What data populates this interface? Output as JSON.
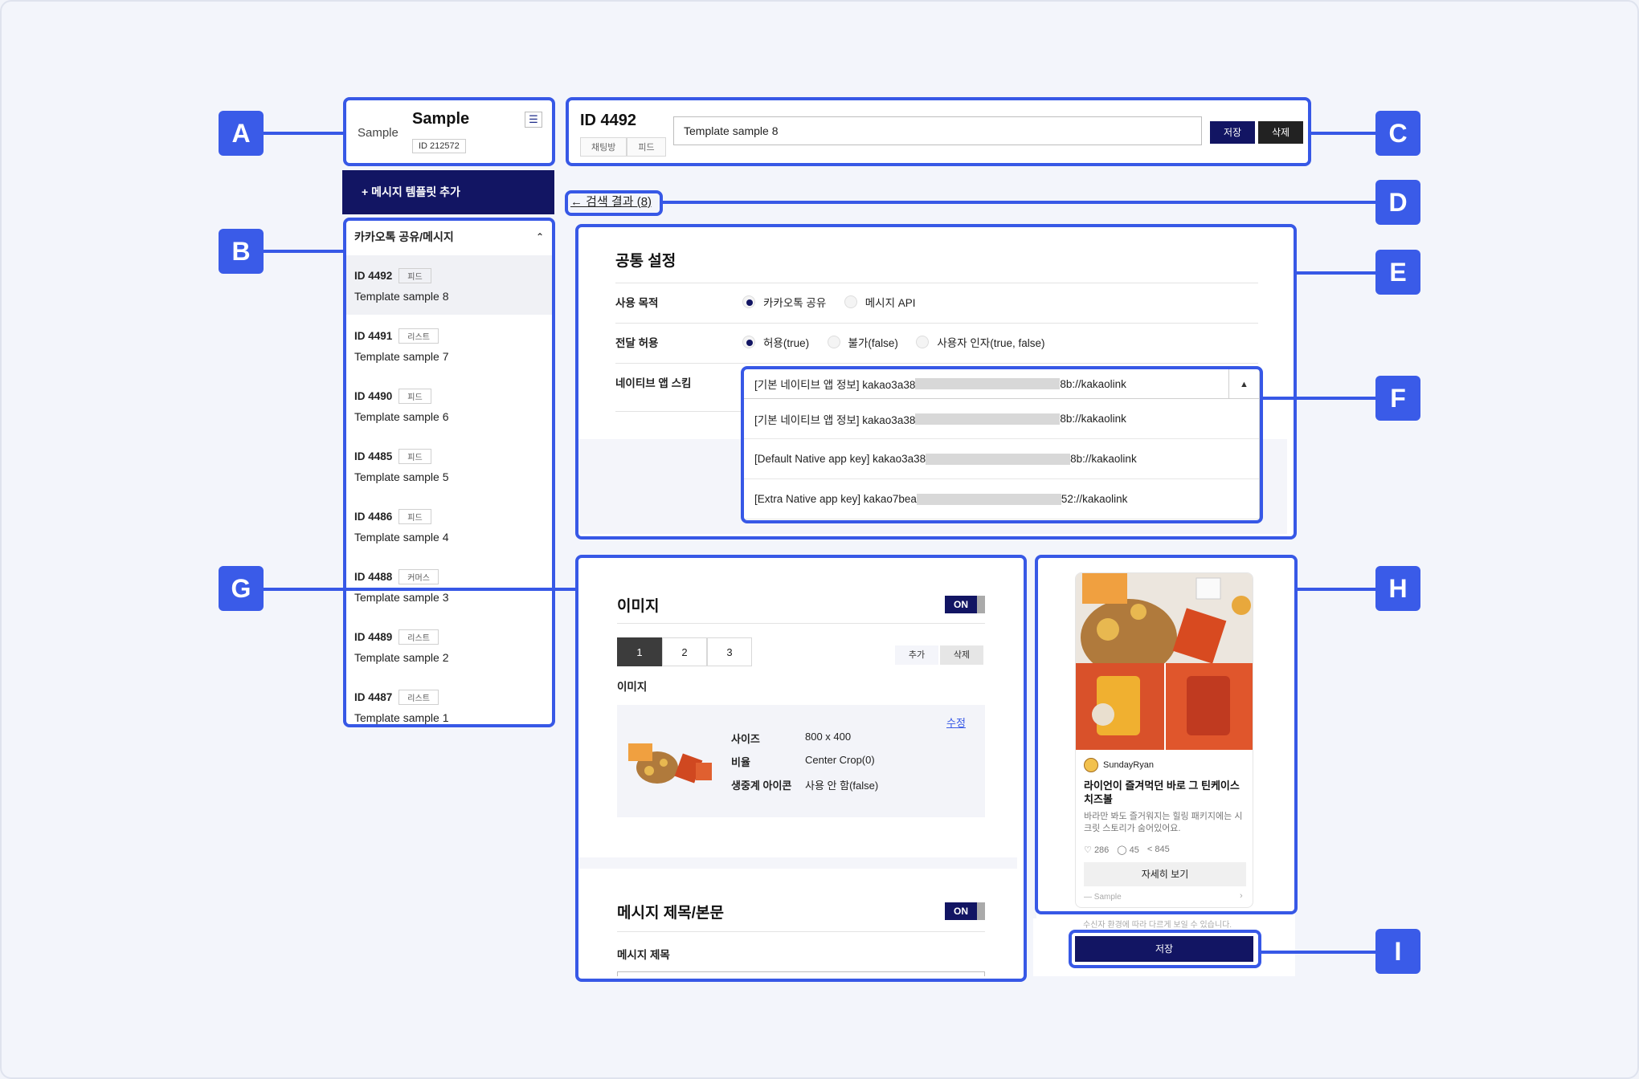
{
  "sidebar": {
    "header": {
      "label": "Sample",
      "title": "Sample",
      "id_tag": "ID 212572"
    },
    "add_button": "+ 메시지 템플릿 추가",
    "list_title": "카카오톡 공유/메시지",
    "items": [
      {
        "id": "ID 4492",
        "type": "피드",
        "name": "Template sample 8",
        "active": true
      },
      {
        "id": "ID 4491",
        "type": "리스트",
        "name": "Template sample 7"
      },
      {
        "id": "ID 4490",
        "type": "피드",
        "name": "Template sample 6"
      },
      {
        "id": "ID 4485",
        "type": "피드",
        "name": "Template sample 5"
      },
      {
        "id": "ID 4486",
        "type": "피드",
        "name": "Template sample 4"
      },
      {
        "id": "ID 4488",
        "type": "커머스",
        "name": "Template sample 3"
      },
      {
        "id": "ID 4489",
        "type": "리스트",
        "name": "Template sample 2"
      },
      {
        "id": "ID 4487",
        "type": "리스트",
        "name": "Template sample 1"
      }
    ]
  },
  "header": {
    "id_title": "ID 4492",
    "tabs": [
      "채팅방",
      "피드"
    ],
    "name_value": "Template sample 8",
    "save_label": "저장",
    "delete_label": "삭제"
  },
  "back_link": "← 검색 결과 (8)",
  "common": {
    "title": "공통 설정",
    "purpose_label": "사용 목적",
    "purpose_options": [
      "카카오톡 공유",
      "메시지 API"
    ],
    "forward_label": "전달 허용",
    "forward_options": [
      "허용(true)",
      "불가(false)",
      "사용자 인자(true, false)"
    ],
    "scheme_label": "네이티브 앱 스킴",
    "scheme_selected_prefix": "[기본 네이티브 앱 정보] kakao3a38",
    "scheme_selected_suffix": "8b://kakaolink",
    "scheme_options": [
      {
        "prefix": "[기본 네이티브 앱 정보] kakao3a38",
        "suffix": "8b://kakaolink"
      },
      {
        "prefix": "[Default Native app key] kakao3a38",
        "suffix": "8b://kakaolink"
      },
      {
        "prefix": "[Extra Native app key] kakao7bea",
        "suffix": "52://kakaolink"
      }
    ]
  },
  "image_section": {
    "title": "이미지",
    "toggle": "ON",
    "pages": [
      "1",
      "2",
      "3"
    ],
    "add_label": "추가",
    "delete_label": "삭제",
    "sub_title": "이미지",
    "edit_link": "수정",
    "specs": [
      {
        "k": "사이즈",
        "v": "800 x 400"
      },
      {
        "k": "비율",
        "v": "Center Crop(0)"
      },
      {
        "k": "생중계 아이콘",
        "v": "사용 안 함(false)"
      }
    ]
  },
  "message_section": {
    "title": "메시지 제목/본문",
    "toggle": "ON",
    "field_label": "메시지 제목"
  },
  "preview": {
    "profile_name": "SundayRyan",
    "title": "라이언이 즐겨먹던 바로 그 틴케이스 치즈볼",
    "description": "바라만 봐도 즐거워지는 힐링 패키지에는 시크릿 스토리가 숨어있어요.",
    "likes": "286",
    "comments": "45",
    "shares": "845",
    "button_label": "자세히 보기",
    "footer_source": "Sample",
    "notice": "수신자 환경에 따라 다르게 보일 수 있습니다.",
    "save_label": "저장"
  },
  "callouts": [
    "A",
    "B",
    "C",
    "D",
    "E",
    "F",
    "G",
    "H",
    "I"
  ],
  "colors": {
    "accent": "#3a5be8",
    "navy": "#121563"
  }
}
